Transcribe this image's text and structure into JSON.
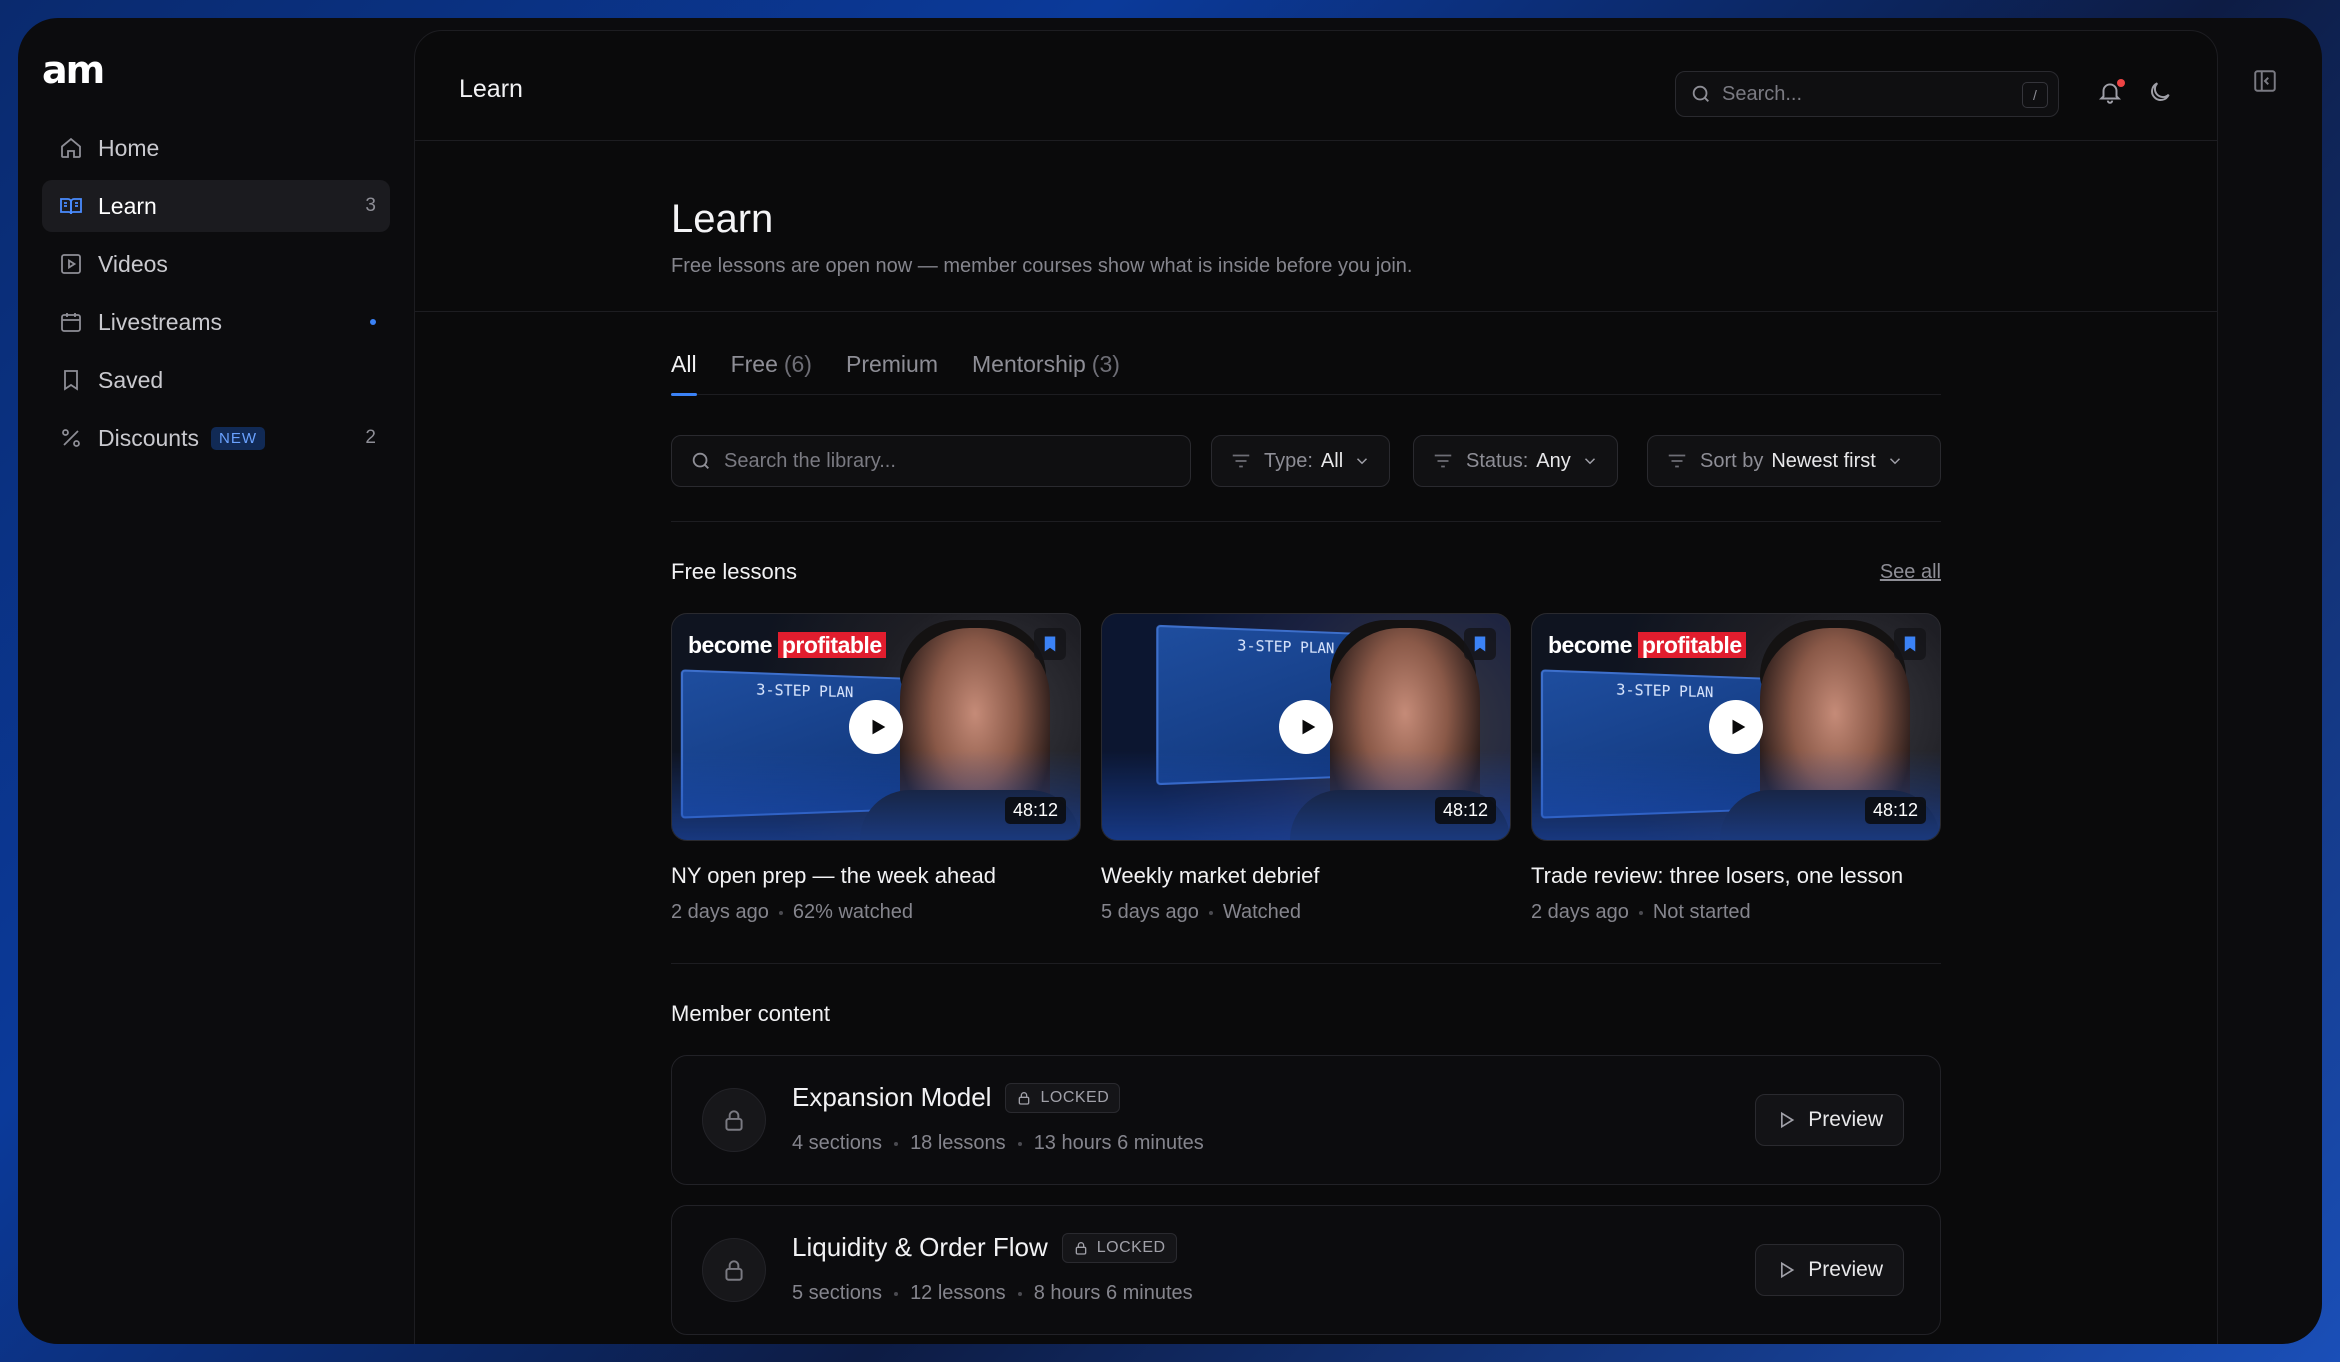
{
  "brand": {
    "logo_text": "am"
  },
  "sidebar": {
    "items": [
      {
        "label": "Home",
        "icon": "home-icon",
        "count": "",
        "active": false
      },
      {
        "label": "Learn",
        "icon": "book-open-icon",
        "count": "3",
        "active": true
      },
      {
        "label": "Videos",
        "icon": "play-square-icon",
        "count": "",
        "active": false
      },
      {
        "label": "Livestreams",
        "icon": "calendar-icon",
        "count": "",
        "active": false,
        "has_dot": true
      },
      {
        "label": "Saved",
        "icon": "bookmark-icon",
        "count": "",
        "active": false
      },
      {
        "label": "Discounts",
        "icon": "percent-icon",
        "count": "2",
        "badge": "NEW",
        "active": false
      }
    ]
  },
  "topbar": {
    "title": "Learn",
    "search_placeholder": "Search...",
    "search_shortcut": "/"
  },
  "page": {
    "title": "Learn",
    "subtitle": "Free lessons are open now — member courses show what is inside before you join."
  },
  "tabs": [
    {
      "label": "All",
      "count": "",
      "active": true
    },
    {
      "label": "Free",
      "count": "(6)",
      "active": false
    },
    {
      "label": "Premium",
      "count": "",
      "active": false
    },
    {
      "label": "Mentorship",
      "count": "(3)",
      "active": false
    }
  ],
  "filters": {
    "search_placeholder": "Search the library...",
    "type_label": "Type:",
    "type_value": "All",
    "status_label": "Status:",
    "status_value": "Any",
    "sort_label": "Sort by",
    "sort_value": "Newest first"
  },
  "free_lessons": {
    "heading": "Free lessons",
    "see_all": "See all",
    "cards": [
      {
        "title": "NY open prep — the week ahead",
        "age": "2 days ago",
        "status": "62% watched",
        "duration": "48:12",
        "headline_a": "become",
        "headline_b": "profitable",
        "board_title": "3-STEP PLAN"
      },
      {
        "title": "Weekly market debrief",
        "age": "5 days ago",
        "status": "Watched",
        "duration": "48:12",
        "headline_a": "",
        "headline_b": "",
        "board_title": "3-STEP PLAN"
      },
      {
        "title": "Trade review: three losers, one lesson",
        "age": "2 days ago",
        "status": "Not started",
        "duration": "48:12",
        "headline_a": "become",
        "headline_b": "profitable",
        "board_title": "3-STEP PLAN"
      }
    ]
  },
  "member_content": {
    "heading": "Member content",
    "courses": [
      {
        "title": "Expansion Model",
        "badge": "LOCKED",
        "sections": "4 sections",
        "lessons": "18 lessons",
        "duration": "13 hours 6 minutes",
        "action": "Preview"
      },
      {
        "title": "Liquidity & Order Flow",
        "badge": "LOCKED",
        "sections": "5 sections",
        "lessons": "12 lessons",
        "duration": "8 hours 6 minutes",
        "action": "Preview"
      }
    ]
  },
  "colors": {
    "accent": "#3b82f6",
    "background": "#0a0a0b",
    "highlight_red": "#e11d2e"
  }
}
